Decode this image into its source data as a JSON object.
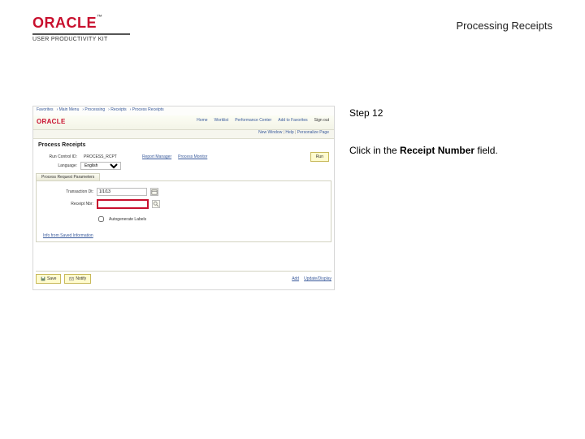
{
  "doc": {
    "title": "Processing Receipts",
    "brand_main": "ORACLE",
    "brand_tm": "™",
    "brand_sub": "USER PRODUCTIVITY KIT"
  },
  "step": {
    "label": "Step 12",
    "instruction_prefix": "Click in the ",
    "instruction_bold": "Receipt Number",
    "instruction_suffix": " field."
  },
  "shot": {
    "breadcrumb": [
      "Favorites",
      "Main Menu",
      "Processing",
      "Receipts",
      "Process Receipts"
    ],
    "mini_logo": "ORACLE",
    "nav": {
      "home": "Home",
      "worklist": "Worklist",
      "perf": "Performance Center",
      "addfav": "Add to Favorites",
      "signout": "Sign out"
    },
    "subbar": {
      "newwin": "New Window",
      "help": "Help",
      "personalize": "Personalize Page"
    },
    "page_title": "Process Receipts",
    "run_control_label": "Run Control ID:",
    "run_control_value": "PROCESS_RCPT",
    "report_mgr": "Report Manager",
    "proc_mon": "Process Monitor",
    "btn_run": "Run",
    "lang_label": "Language:",
    "lang_value": "English",
    "section_title": "Process Request Parameters",
    "field1_label": "Transaction Dt:",
    "field1_value": "1/1/13",
    "field2_label": "Receipt Nbr:",
    "field2_value": "",
    "cb_label": "Autogenerate Labels",
    "pii_link": "Info from Saved Information",
    "footer": {
      "save": "Save",
      "notify": "Notify",
      "add": "Add",
      "update": "Update/Display"
    }
  }
}
